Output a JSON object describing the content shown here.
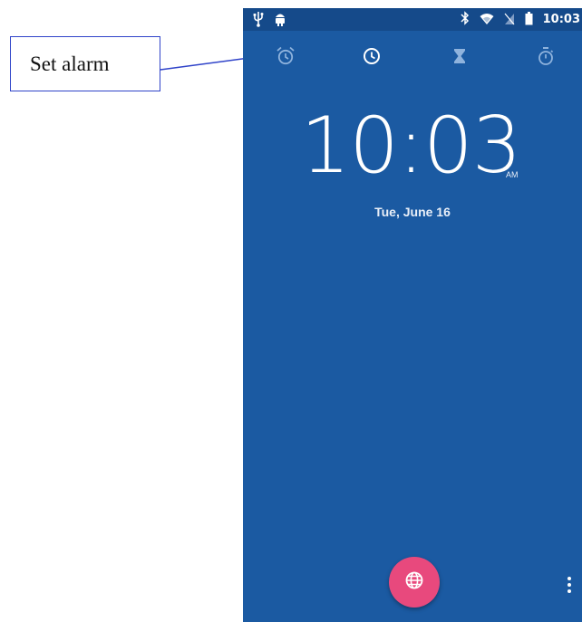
{
  "annotation": {
    "label": "Set alarm"
  },
  "status_bar": {
    "time": "10:03",
    "left_icons": [
      "usb-icon",
      "android-debug-icon"
    ],
    "right_icons": [
      "bluetooth-icon",
      "wifi-icon",
      "no-sim-icon",
      "battery-icon"
    ]
  },
  "tabs": [
    {
      "name": "alarm-tab",
      "icon": "alarm-clock-icon",
      "selected": false
    },
    {
      "name": "clock-tab",
      "icon": "clock-icon",
      "selected": true
    },
    {
      "name": "timer-tab",
      "icon": "hourglass-icon",
      "selected": false
    },
    {
      "name": "stopwatch-tab",
      "icon": "stopwatch-icon",
      "selected": false
    }
  ],
  "clock": {
    "time": "10:03",
    "ampm": "AM",
    "date": "Tue, June 16"
  },
  "fab": {
    "icon": "globe-icon"
  },
  "menu": {
    "icon": "more-vert-icon"
  },
  "colors": {
    "background": "#1b5aa2",
    "status_bar": "#154a8a",
    "fab": "#e8497d",
    "callout_border": "#2f43c9"
  }
}
